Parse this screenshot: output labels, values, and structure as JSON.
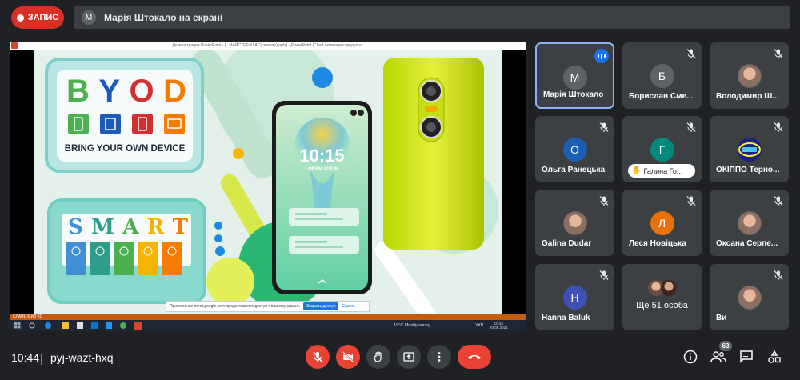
{
  "record": {
    "label": "ЗАПИС"
  },
  "presenting": {
    "initial": "М",
    "text": "Марія Штокало на екрані"
  },
  "window": {
    "title": "Демонстрация PowerPoint - [...МАЙСТЕР-КЛАС(семінар).pptx] - PowerPoint (Сбой активации продукта)"
  },
  "slide": {
    "byod_letters": [
      "B",
      "Y",
      "O",
      "D"
    ],
    "byod_caption": "BRING YOUR OWN DEVICE",
    "smart_letters": [
      "S",
      "M",
      "A",
      "R",
      "T"
    ],
    "phone_time": "10:15",
    "phone_sub": "LOREM IPSUM"
  },
  "notification": {
    "text": "Приложение meet.google.com предоставляет доступ к вашему экрану.",
    "button": "Закрыть доступ",
    "link": "Скрыть"
  },
  "statusbar": {
    "text": "СЛАЙД 6 ИЗ 31"
  },
  "taskbar": {
    "weather": "19°C  Mostly sunny",
    "lang": "УКР",
    "time": "10:44",
    "date": "20.08.2021"
  },
  "participants": [
    {
      "name": "Марія Штокало",
      "initial": "М",
      "color": "#5f6368",
      "speaking": true
    },
    {
      "name": "Борислав Сме...",
      "initial": "Б",
      "color": "#5f6368",
      "muted": true
    },
    {
      "name": "Володимир Ш...",
      "photo": true,
      "muted": true
    },
    {
      "name": "Ольга Ранецька",
      "initial": "О",
      "color": "#1a5fb4",
      "muted": true
    },
    {
      "initial": "Г",
      "color": "#00897b",
      "hand_text": "Галина Го...",
      "muted": true
    },
    {
      "name": "ОКІППО Терно...",
      "logo": true,
      "muted": true
    },
    {
      "name": "Galina Dudar",
      "photo": true,
      "muted": true
    },
    {
      "name": "Леся Новіцька",
      "initial": "Л",
      "color": "#e8710a",
      "muted": true
    },
    {
      "name": "Оксана Серпе...",
      "photo": true,
      "muted": true
    },
    {
      "name": "Hanna Baluk",
      "initial": "H",
      "color": "#3f51b5",
      "muted": true
    },
    {
      "more_text": "Ще 51 особа"
    },
    {
      "name": "Ви",
      "photo": true,
      "muted": true
    }
  ],
  "bottom": {
    "time": "10:44",
    "separator": "|",
    "meeting_code": "pyj-wazt-hxq",
    "participants_count": "63"
  },
  "colors": {
    "accent": "#8ab4f8",
    "danger": "#ea4335",
    "tile": "#3c4043",
    "background": "#202124"
  }
}
